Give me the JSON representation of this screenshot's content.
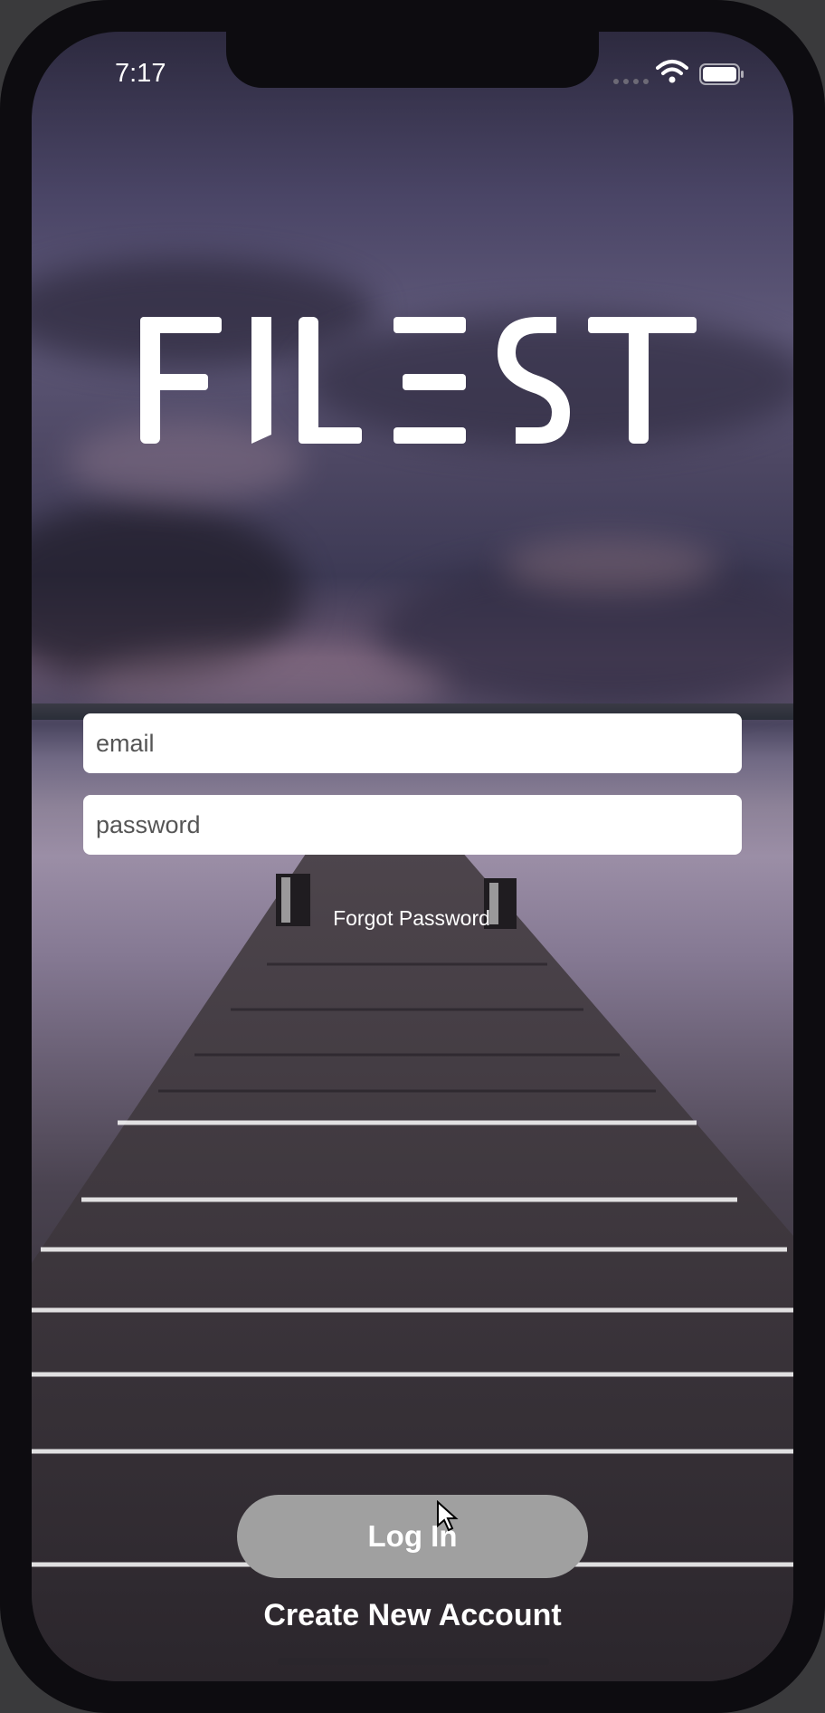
{
  "status_bar": {
    "time": "7:17"
  },
  "logo": {
    "text": "FILEST"
  },
  "login_form": {
    "email_placeholder": "email",
    "email_value": "",
    "password_placeholder": "password",
    "password_value": "",
    "forgot_password_label": "Forgot Password",
    "login_label": "Log In",
    "create_account_label": "Create New Account"
  },
  "icons": {
    "wifi": "wifi-icon",
    "battery": "battery-icon",
    "signal": "signal-icon",
    "cursor": "cursor-icon"
  },
  "colors": {
    "login_button": "#a0a0a0",
    "field_background": "#ffffff",
    "text": "#ffffff"
  }
}
